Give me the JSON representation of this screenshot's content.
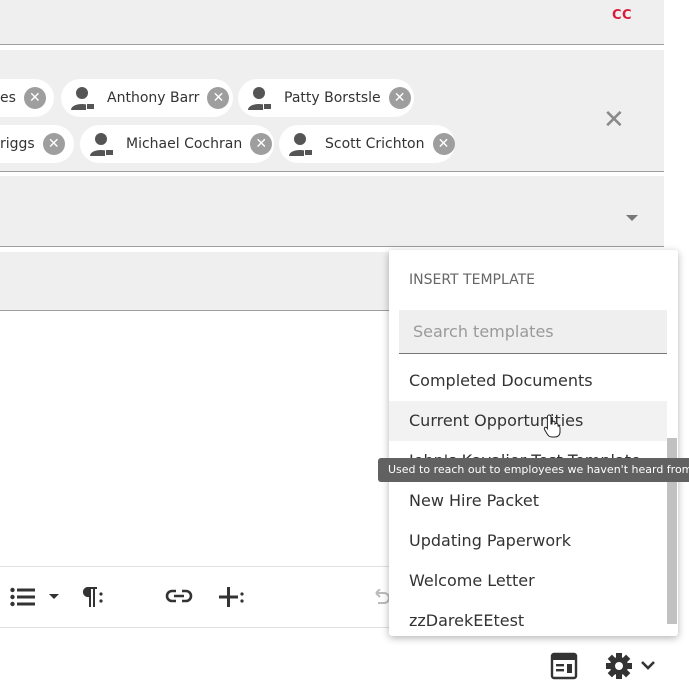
{
  "header": {
    "cc_label": "CC"
  },
  "recipients": {
    "row1": [
      {
        "name": "es"
      },
      {
        "name": "Anthony Barr"
      },
      {
        "name": "Patty Borstsle"
      }
    ],
    "row2": [
      {
        "name": "riggs"
      },
      {
        "name": "Michael Cochran"
      },
      {
        "name": "Scott Crichton"
      }
    ]
  },
  "template_panel": {
    "title": "INSERT TEMPLATE",
    "search_placeholder": "Search templates",
    "items": [
      "Completed Documents",
      "Current Opportunities",
      "John's Kavalier Test Template",
      "New Hire Packet",
      "Updating Paperwork",
      "Welcome Letter",
      "zzDarekEEtest"
    ],
    "hovered_index": 1
  },
  "tooltip": {
    "text": "Used to reach out to employees we haven't heard from"
  },
  "icons": {
    "remove": "close-circle-icon",
    "avatar": "person-icon",
    "clear": "close-icon",
    "list": "bulleted-list-icon",
    "paragraph": "paragraph-icon",
    "link": "link-icon",
    "insert": "insert-field-icon",
    "undo": "undo-icon",
    "template": "template-icon",
    "settings": "gear-icon"
  },
  "colors": {
    "cc": "#d81b3a",
    "chip_remove": "#9e9e9e",
    "tooltip_bg": "#616161"
  }
}
